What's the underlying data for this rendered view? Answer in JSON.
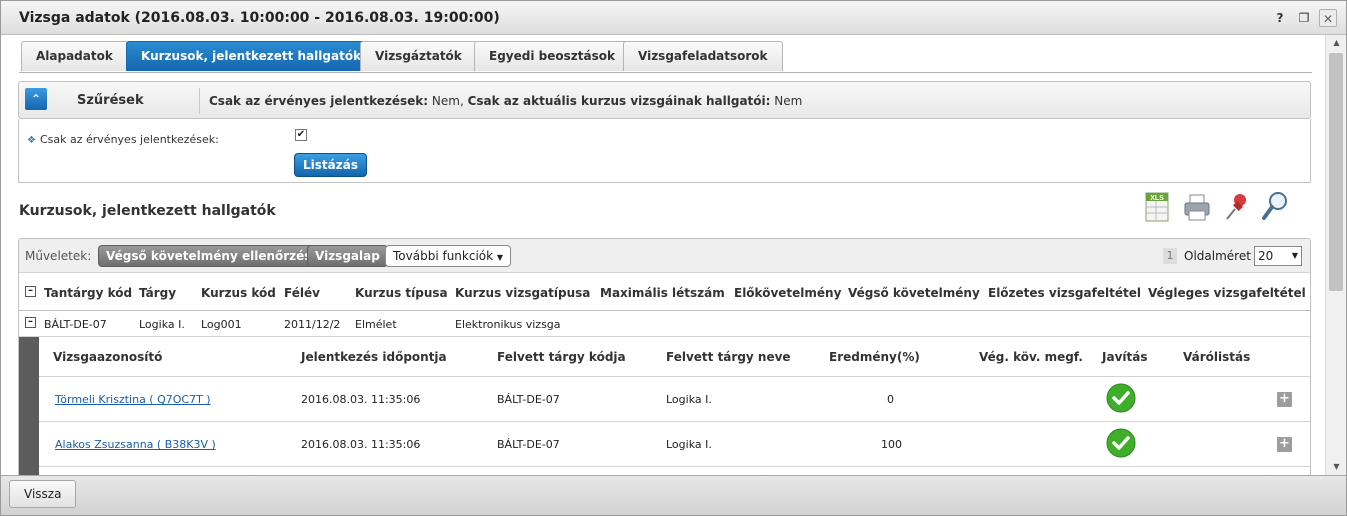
{
  "window": {
    "title": "Vizsga adatok (2016.08.03. 10:00:00 - 2016.08.03. 19:00:00)",
    "help_label": "?",
    "restore_label": "❐",
    "close_label": "✕"
  },
  "tabs": [
    {
      "label": "Alapadatok"
    },
    {
      "label": "Kurzusok, jelentkezett hallgatók"
    },
    {
      "label": "Vizsgáztatók"
    },
    {
      "label": "Egyedi beosztások"
    },
    {
      "label": "Vizsgafeladatsorok"
    }
  ],
  "active_tab": "Kurzusok, jelentkezett hallgatók",
  "filter": {
    "title": "Szűrések",
    "summary_label_1": "Csak az érvényes jelentkezések:",
    "summary_value_1": " Nem, ",
    "summary_label_2": "Csak az aktuális kurzus vizsgáinak hallgatói:",
    "summary_value_2": " Nem",
    "field_label": "Csak az érvényes jelentkezések:",
    "field_checked": true,
    "list_button": "Listázás"
  },
  "section_title": "Kurzusok, jelentkezett hallgatók",
  "toolbar_icons": [
    "xls-export-icon",
    "printer-icon",
    "pin-icon",
    "magnifier-icon"
  ],
  "toolbar_icon_xls": "XLS",
  "toolbar": {
    "label": "Műveletek:",
    "btn_check": "Végső követelmény ellenőrzése",
    "btn_sheet": "Vizsgalap",
    "btn_more": "További funkciók",
    "page_number": "1",
    "page_size_label": "Oldalméret",
    "page_size_value": "20"
  },
  "table": {
    "headers": [
      "Tantárgy kód",
      "Tárgy",
      "Kurzus kód",
      "Félév",
      "Kurzus típusa",
      "Kurzus vizsgatípusa",
      "Maximális létszám",
      "Előkövetelmény",
      "Végső követelmény",
      "Előzetes vizsgafeltétel",
      "Végleges vizsgafeltétel"
    ],
    "rows": [
      {
        "subject_code": "BÁLT-DE-07",
        "subject": "Logika I.",
        "course_code": "Log001",
        "semester": "2011/12/2",
        "course_type": "Elmélet",
        "exam_type": "Elektronikus vizsga"
      }
    ]
  },
  "subtable": {
    "headers": [
      "Vizsgaazonosító",
      "Jelentkezés időpontja",
      "Felvett tárgy kódja",
      "Felvett tárgy neve",
      "Eredmény(%)",
      "Vég. köv. megf.",
      "Javítás",
      "Várólistás"
    ],
    "rows": [
      {
        "name": "Törmeli Krisztina ( Q7OC7T )",
        "applied": "2016.08.03. 11:35:06",
        "code": "BÁLT-DE-07",
        "subject": "Logika I.",
        "result": "0"
      },
      {
        "name": "Alakos Zsuzsanna ( B38K3V )",
        "applied": "2016.08.03. 11:35:06",
        "code": "BÁLT-DE-07",
        "subject": "Logika I.",
        "result": "100"
      }
    ]
  },
  "footer": {
    "back_button": "Vissza"
  },
  "colors": {
    "accent": "#1467ad",
    "ok": "#3fae2a"
  }
}
